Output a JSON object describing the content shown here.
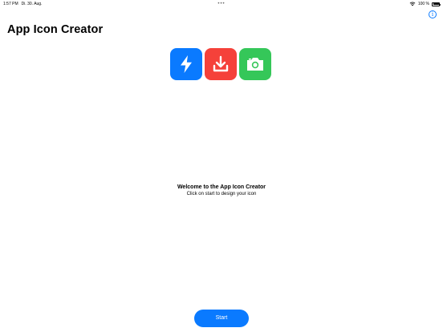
{
  "status_bar": {
    "time": "1:57 PM",
    "date": "Di. 30. Aug.",
    "center_dots": "•••",
    "battery_text": "100 %"
  },
  "header": {
    "title": "App Icon Creator",
    "info_icon": "info-circle-icon"
  },
  "icons": [
    {
      "name": "lightning-bolt-icon",
      "color": "#0a7aff"
    },
    {
      "name": "download-icon",
      "color": "#f5413a"
    },
    {
      "name": "camera-icon",
      "color": "#35c759"
    }
  ],
  "welcome": {
    "title": "Welcome to the App Icon Creator",
    "subtitle": "Click on start to design your icon"
  },
  "start_button": {
    "label": "Start"
  },
  "colors": {
    "accent": "#0a7aff"
  }
}
